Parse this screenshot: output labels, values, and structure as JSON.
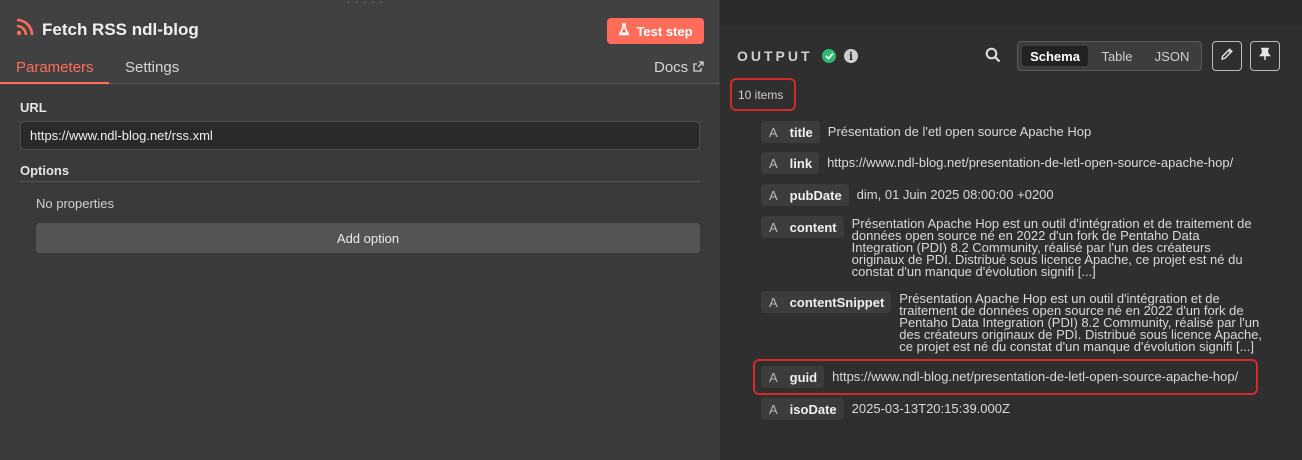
{
  "node": {
    "title": "Fetch RSS ndl-blog",
    "test_button_label": "Test step",
    "tabs": [
      {
        "label": "Parameters",
        "active": true
      },
      {
        "label": "Settings",
        "active": false
      }
    ],
    "docs_label": "Docs",
    "accent_color": "#ff6d5a"
  },
  "params": {
    "url_label": "URL",
    "url_value": "https://www.ndl-blog.net/rss.xml",
    "options_label": "Options",
    "no_properties": "No properties",
    "add_option_label": "Add option"
  },
  "output": {
    "title": "OUTPUT",
    "status": "success",
    "views": [
      "Schema",
      "Table",
      "JSON"
    ],
    "active_view": "Schema",
    "items_count": "10 items",
    "fields": [
      {
        "type": "A",
        "key": "title",
        "value": "Présentation de l'etl open source Apache Hop"
      },
      {
        "type": "A",
        "key": "link",
        "value": "https://www.ndl-blog.net/presentation-de-letl-open-source-apache-hop/"
      },
      {
        "type": "A",
        "key": "pubDate",
        "value": "dim, 01 Juin 2025 08:00:00 +0200"
      },
      {
        "type": "A",
        "key": "content",
        "value": "Présentation Apache Hop est un outil d'intégration et de traitement de données open source né en 2022 d'un fork de Pentaho Data Integration (PDI) 8.2 Community, réalisé par l'un des créateurs originaux de PDI. Distribué sous licence Apache, ce projet est né du constat d'un manque d'évolution signifi [...]"
      },
      {
        "type": "A",
        "key": "contentSnippet",
        "value": "Présentation Apache Hop est un outil d'intégration et de traitement de données open source né en 2022 d'un fork de Pentaho Data Integration (PDI) 8.2 Community, réalisé par l'un des créateurs originaux de PDI. Distribué sous licence Apache, ce projet est né du constat d'un manque d'évolution signifi [...]"
      },
      {
        "type": "A",
        "key": "guid",
        "value": "https://www.ndl-blog.net/presentation-de-letl-open-source-apache-hop/"
      },
      {
        "type": "A",
        "key": "isoDate",
        "value": "2025-03-13T20:15:39.000Z"
      }
    ],
    "success_color": "#2eb872",
    "highlight_color": "#d42a2a"
  },
  "icons": {
    "node": "rss-icon",
    "test": "flask-icon",
    "docs": "external-link-icon",
    "search": "search-icon",
    "edit": "pencil-icon",
    "pin": "pin-icon"
  }
}
